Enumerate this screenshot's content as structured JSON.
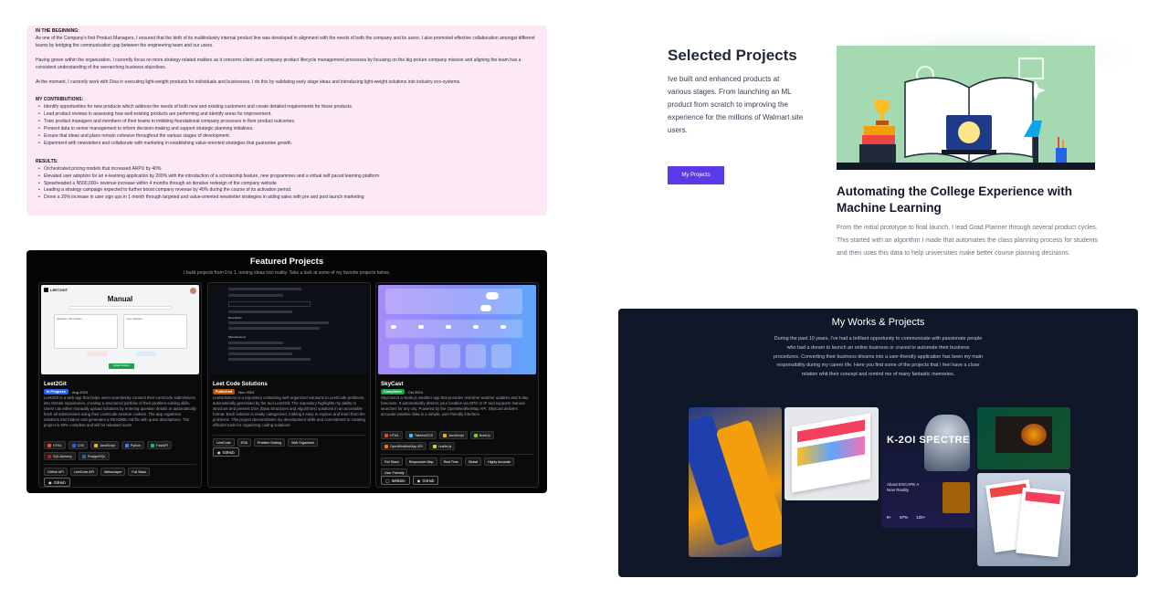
{
  "about": {
    "beginning_heading": "IN THE BEGINNING:",
    "beginning_text": "As one of the Company's first Product Managers, I ensured that the birth of its multiindustry internal product line was developed in alignment with the needs of both the company and its users. I also promoted effective collaboration amongst different teams by bridging the communication gap between the engineering team and our users.",
    "growth_text": "Having grown within the organization, I currently focus on more strategy related matters as it concerns client and company product lifecycle management processes by focusing on the big picture company mission and aligning the team has a consistent understanding of the overarching business objectives.",
    "current_text": "At the moment, I currently work with Diva in executing light-weight products for individuals and businesses. I do this by validating early stage ideas and introducing light-weight solutions into industry eco-systems.",
    "contributions_heading": "MY CONTRIBUTIONS:",
    "contributions": [
      "Identify opportunities for new products which address the needs of both new and existing customers and create detailed requirements for these products.",
      "Lead product reviews in assessing how well existing products are performing and identify areas for improvement.",
      "Train product managers and members of their teams in imbibing foundational company processes in their product outcomes.",
      "Present data to senior management to inform decision-making and support strategic planning initiatives.",
      "Ensure that ideas and plans remain cohesive throughout the various stages of development.",
      "Experiment with newsletters and collaborate with marketing in establishing value-oriented strategies that guarantee growth."
    ],
    "results_heading": "RESULTS:",
    "results": [
      "Orchestrated pricing models that increased ARPU by 40%",
      "Elevated user adoption for an e-learning application by 200% with the introduction of a scholarship feature, new programmes and a virtual self paced learning platform",
      "Spearheaded a N500,000+ revenue increase within 4 months through an iterative redesign of the company website",
      "Leading a strategy campaign expected to further boost company revenue by 40% during the course of its activation period.",
      "Drove a 20% increase in user sign ups in 1 month through targeted and value-oriented newsletter strategies in aiding sales with pre and post launch marketing"
    ]
  },
  "featured": {
    "title": "Featured Projects",
    "subtitle": "I build projects from 0 to 1, turning ideas into reality. Take a look at some of my favorite projects below.",
    "cards": [
      {
        "name": "Leet2Git",
        "status": "In Progress",
        "status_color": "#2563eb",
        "date": "Aug 2024",
        "description": "Leet2Git is a web app that helps users seamlessly connect their LeetCode submissions into GitHub repositories, creating a structured portfolio of their problem-solving skills. Users can either manually upload solutions by entering question details or automatically fetch all submissions using their LeetCode session cookies. The app organizes solutions into folders and generates a README.md file with quest descriptions. The project is 90% complete and will be released soon!",
        "tech": [
          "HTML",
          "CSS",
          "JavaScript",
          "Python",
          "FastAPI",
          "SQLAlchemy",
          "PostgreSQL"
        ],
        "tags": [
          "GitHub API",
          "LeetCode API",
          "Webscraper",
          "Full Stack"
        ],
        "buttons": [
          "GitHub"
        ],
        "shot": {
          "logo": "LEET2GIT",
          "heading": "Manual",
          "action": "Upload Solution",
          "box_left": "Question Information",
          "box_right": "Your Solution"
        }
      },
      {
        "name": "Leet Code Solutions",
        "status": "Published",
        "status_color": "#b45309",
        "date": "Nov 2024",
        "description": "LeetSolutions is a repository containing well-organized solutions to LeetCode problems, automatically generated by the tool Leet2Git. The repository highlights my ability to structure and present DSA (Data Structures and Algorithms) solutions in an accessible format. Each solution is neatly categorized, making it easy to explore and learn from the problems. This project demonstrates my development skills and commitment to creating efficient tools for organizing coding solutions.",
        "tech": [],
        "tags": [
          "LeetCode",
          "DSA",
          "Problem Solving",
          "Well Organized"
        ],
        "buttons": [
          "GitHub"
        ],
        "shot": {
          "label_a": "Description",
          "label_b": "Miscellaneous"
        }
      },
      {
        "name": "SkyCast",
        "status": "Completed",
        "status_color": "#16a34a",
        "date": "Oct 2024",
        "description": "SkyCast is a Node.js weather app that provides real-time weather updates and 5-day forecasts. It automatically detects your location via GPS or IP and supports manual searches for any city. Powered by the OpenWeatherMap API, SkyCast delivers accurate weather data in a simple, user-friendly interface.",
        "tech": [
          "HTML",
          "TailwindCSS",
          "JavaScript",
          "Node.js",
          "OpenWeatherMap API",
          "Leaflet.js"
        ],
        "tags": [
          "Full Stack",
          "Responsive Map",
          "Real Time",
          "Global",
          "Highly Accurate",
          "User Friendly"
        ],
        "buttons": [
          "Website",
          "GitHub"
        ]
      }
    ],
    "tech_colors": {
      "HTML": "#e34c26",
      "CSS": "#2563eb",
      "JavaScript": "#eab308",
      "Python": "#3b82f6",
      "FastAPI": "#10b981",
      "SQLAlchemy": "#b91c1c",
      "PostgreSQL": "#336791",
      "TailwindCSS": "#38bdf8",
      "Node.js": "#84cc16",
      "OpenWeatherMap API": "#f97316",
      "Leaflet.js": "#a3e635"
    }
  },
  "selected": {
    "title": "Selected Projects",
    "description": "Ive built and enhanced products at various stages. From launching an ML product from scratch to improving the experience for the millions of Walmart site users.",
    "button": "My Projects",
    "accent": "#5b39e8",
    "case_title": "Automating the College Experience with Machine Learning",
    "case_description": "From the initial prototype to final launch, I lead Grad Planner through several product cycles. This started with an algorithm I made that automates the class planning process for students and then uses this data to help universities make better course planning decisions."
  },
  "works": {
    "title": "My Works & Projects",
    "description": "During the past 10 years, I've had a brilliant opportunity to communicate with passionate people who had a dream to launch an online business or craved to automate their business procedures. Converting their business dreams into a user-friendly application has been my main responsibility during my career life. Here you find some of the projects that I feel have a close relation whit their concept and remind me of many fantastic memories.",
    "tiles": {
      "game_title": "K-2OI SPECTRE",
      "game_sub": "About ESCAPE A New Reality",
      "stats": [
        "9+",
        "97%",
        "120+"
      ]
    }
  }
}
